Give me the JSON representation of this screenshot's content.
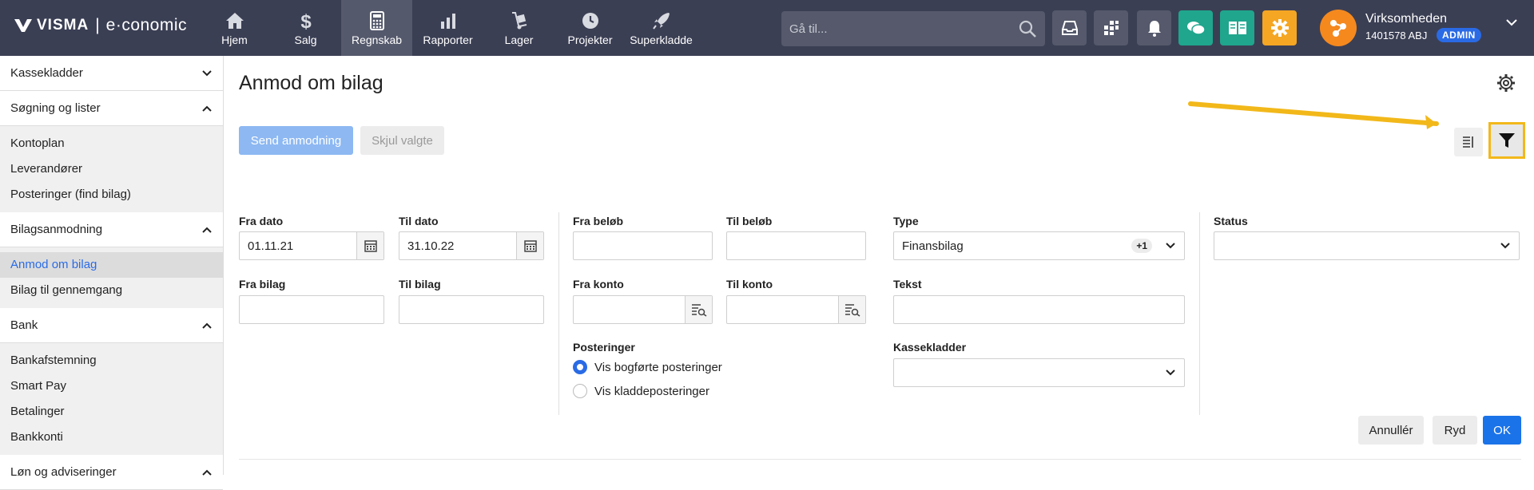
{
  "brand": {
    "name": "VISMA",
    "separator": "|",
    "product": "e·conomic"
  },
  "nav": [
    {
      "label": "Hjem",
      "icon": "home-icon"
    },
    {
      "label": "Salg",
      "icon": "dollar-icon"
    },
    {
      "label": "Regnskab",
      "icon": "calculator-icon",
      "active": true
    },
    {
      "label": "Rapporter",
      "icon": "bar-chart-icon"
    },
    {
      "label": "Lager",
      "icon": "hand-truck-icon"
    },
    {
      "label": "Projekter",
      "icon": "clock-icon"
    },
    {
      "label": "Superkladde",
      "icon": "rocket-icon"
    }
  ],
  "search": {
    "placeholder": "Gå til..."
  },
  "user": {
    "company": "Virksomheden",
    "account": "1401578 ABJ",
    "role": "ADMIN"
  },
  "sidebar": {
    "sections": [
      {
        "title": "Kassekladder",
        "expanded": false,
        "items": []
      },
      {
        "title": "Søgning og lister",
        "expanded": true,
        "items": [
          "Kontoplan",
          "Leverandører",
          "Posteringer (find bilag)"
        ]
      },
      {
        "title": "Bilagsanmodning",
        "expanded": true,
        "items": [
          "Anmod om bilag",
          "Bilag til gennemgang"
        ]
      },
      {
        "title": "Bank",
        "expanded": true,
        "items": [
          "Bankafstemning",
          "Smart Pay",
          "Betalinger",
          "Bankkonti"
        ]
      },
      {
        "title": "Løn og adviseringer",
        "expanded": true,
        "items": []
      }
    ],
    "active_item": "Anmod om bilag"
  },
  "page": {
    "title": "Anmod om bilag",
    "send_label": "Send anmodning",
    "hide_label": "Skjul valgte"
  },
  "filters": {
    "fra_dato": {
      "label": "Fra dato",
      "value": "01.11.21"
    },
    "til_dato": {
      "label": "Til dato",
      "value": "31.10.22"
    },
    "fra_bilag": {
      "label": "Fra bilag",
      "value": ""
    },
    "til_bilag": {
      "label": "Til bilag",
      "value": ""
    },
    "fra_belob": {
      "label": "Fra beløb",
      "value": ""
    },
    "til_belob": {
      "label": "Til beløb",
      "value": ""
    },
    "fra_konto": {
      "label": "Fra konto",
      "value": ""
    },
    "til_konto": {
      "label": "Til konto",
      "value": ""
    },
    "posteringer": {
      "label": "Posteringer",
      "options": [
        "Vis bogførte posteringer",
        "Vis kladdeposteringer"
      ],
      "selected": "Vis bogførte posteringer"
    },
    "type": {
      "label": "Type",
      "value": "Finansbilag",
      "extra": "+1"
    },
    "tekst": {
      "label": "Tekst",
      "value": ""
    },
    "kassekladder": {
      "label": "Kassekladder",
      "value": ""
    },
    "status": {
      "label": "Status",
      "value": ""
    }
  },
  "footer": {
    "cancel": "Annullér",
    "clear": "Ryd",
    "ok": "OK"
  },
  "colors": {
    "topbar": "#3b3f54",
    "primary": "#1a73e8",
    "highlight": "#f2b81a"
  }
}
